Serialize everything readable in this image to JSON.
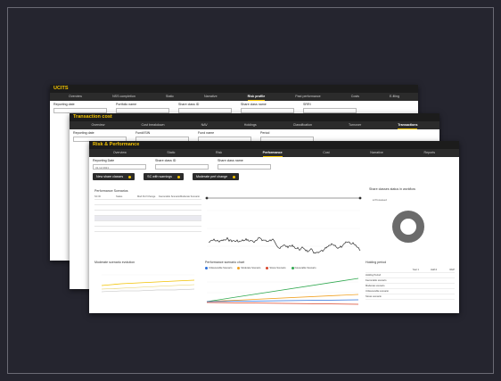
{
  "win_back": {
    "title": "UCITS",
    "tabs": [
      "Overview",
      "NSS completion",
      "Static",
      "Narrative",
      "Risk profile",
      "Past performance",
      "Costs",
      "E-filing"
    ],
    "active_tab": 4,
    "filters": [
      "Reporting date",
      "Portfolio name",
      "Share class ID",
      "Share class name",
      "SRRI"
    ]
  },
  "win_mid": {
    "title": "Transaction cost",
    "tabs": [
      "Overview",
      "Cost breakdown",
      "NAV",
      "Holdings",
      "Classification",
      "Turnover",
      "Transactions"
    ],
    "active_tab": 6,
    "filters": [
      "Reporting date",
      "Fund/ISIN",
      "Fund name",
      "Period"
    ]
  },
  "win_front": {
    "title": "Risk & Performance",
    "tabs": [
      "Overview",
      "Static",
      "Risk",
      "Performance",
      "Cost",
      "Narrative",
      "Reports"
    ],
    "active_tab": 3,
    "filters": [
      {
        "label": "Reporting Date",
        "value": "31.12.2021"
      },
      {
        "label": "Share class ID",
        "value": ""
      },
      {
        "label": "Share class name",
        "value": ""
      }
    ],
    "buttons": [
      "New share classes",
      "SC with warnings",
      "Moderate perf change"
    ],
    "perf_title": "Performance Scenarios",
    "perf_table": {
      "headers": [
        "SC ID",
        "Status",
        "Mod Perf Change",
        "Favourable Scenario",
        "Moderate Scenario"
      ],
      "rows": [
        [
          "",
          "",
          "",
          "",
          ""
        ],
        [
          "",
          "",
          "",
          "",
          ""
        ],
        [
          "",
          "",
          "",
          "",
          ""
        ],
        [
          "",
          "",
          "",
          "",
          ""
        ],
        [
          "",
          "",
          "",
          "",
          ""
        ],
        [
          "",
          "",
          "",
          "",
          ""
        ]
      ]
    },
    "share_status_title": "Share classes status in workflow",
    "ring_value": "5",
    "ring_legend": "Processed",
    "mod_eval_title": "Moderate scenario evolution",
    "perf_chart_title": "Performance scenario chart",
    "perf_chart_legend": [
      "Unfavourable Scenario",
      "Moderate Scenario",
      "Stress Scenario",
      "Favourable Scenario"
    ],
    "holding_title": "Holding period",
    "holding_table": {
      "headers": [
        "",
        "Year 1",
        "Half-3",
        "RHP"
      ],
      "rows": [
        [
          "Holding Period",
          "",
          "",
          ""
        ],
        [
          "Favourable scenario",
          "",
          "",
          ""
        ],
        [
          "Moderate scenario",
          "",
          "",
          ""
        ],
        [
          "Unfavourable scenario",
          "",
          "",
          ""
        ],
        [
          "Stress scenario",
          "",
          "",
          ""
        ]
      ]
    },
    "colors": {
      "accent": "#f2c200",
      "green": "#2fa84f",
      "blue": "#2a6fdb",
      "red": "#d9452b",
      "orange": "#f0a020"
    }
  }
}
